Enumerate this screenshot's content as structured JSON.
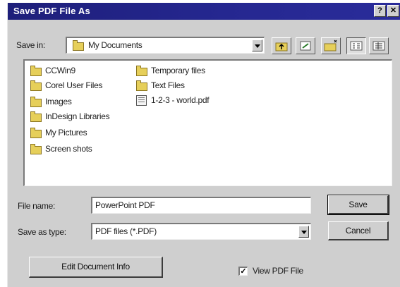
{
  "dialog": {
    "title": "Save PDF File As",
    "help_button": "?",
    "close_button": "✕"
  },
  "save_in": {
    "label": "Save in:",
    "value": "My Documents"
  },
  "toolbar": {
    "buttons": [
      "up-one-level",
      "desktop",
      "create-new-folder",
      "list-view",
      "details-view"
    ]
  },
  "files": {
    "column1": [
      "CCWin9",
      "Corel User Files",
      "Images",
      "InDesign Libraries",
      "My Pictures",
      "Screen shots"
    ],
    "column2_folders": [
      "Temporary files",
      "Text Files"
    ],
    "column2_file": "1-2-3 - world.pdf"
  },
  "file_name": {
    "label": "File name:",
    "value": "PowerPoint PDF"
  },
  "save_as_type": {
    "label": "Save as type:",
    "value": "PDF files (*.PDF)"
  },
  "buttons": {
    "save": "Save",
    "cancel": "Cancel",
    "edit_info": "Edit Document Info"
  },
  "view_pdf": {
    "label": "View PDF File",
    "checked": true,
    "check_mark": "✓"
  }
}
